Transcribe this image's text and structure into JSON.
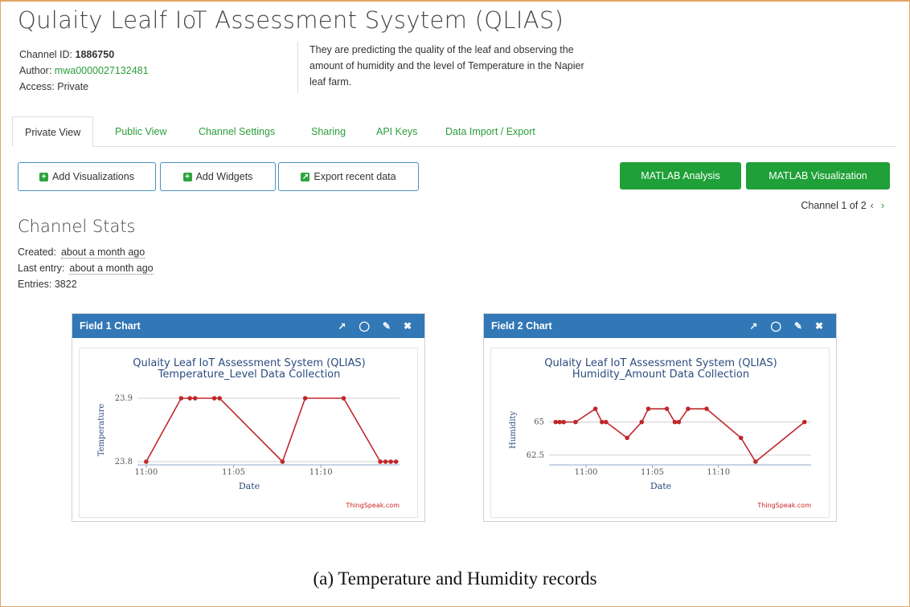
{
  "header": {
    "title": "Qulaity Lealf IoT Assessment Sysytem (QLIAS)",
    "channel_id_label": "Channel ID:",
    "channel_id": "1886750",
    "author_label": "Author:",
    "author": "mwa0000027132481",
    "access": "Access: Private",
    "description": "They are predicting the quality of the leaf and observing the amount of humidity and the level of Temperature in the Napier leaf farm."
  },
  "tabs": [
    "Private View",
    "Public View",
    "Channel Settings",
    "Sharing",
    "API Keys",
    "Data Import / Export"
  ],
  "toolbar": {
    "add_visualizations": "Add Visualizations",
    "add_widgets": "Add Widgets",
    "export_recent": "Export recent data",
    "matlab_analysis": "MATLAB Analysis",
    "matlab_visualization": "MATLAB Visualization",
    "pager": "Channel 1 of 2",
    "accent": "#1fa038"
  },
  "stats": {
    "heading": "Channel Stats",
    "created_label": "Created:",
    "created": "about a month ago",
    "last_entry_label": "Last entry:",
    "last_entry": "about a month ago",
    "entries": "Entries: 3822"
  },
  "panels": [
    {
      "header": "Field 1 Chart"
    },
    {
      "header": "Field 2 Chart"
    }
  ],
  "icons": [
    "external-link-icon",
    "comment-icon",
    "pencil-icon",
    "close-icon"
  ],
  "caption": "(a) Temperature and Humidity records",
  "chart_data": [
    {
      "type": "line",
      "title": "Qulaity Leaf IoT Assessment System (QLIAS)",
      "subtitle": "Temperature_Level Data Collection",
      "xlabel": "Date",
      "ylabel": "Temperature",
      "credit": "ThingSpeak.com",
      "x_ticks": [
        "11:00",
        "11:05",
        "11:10"
      ],
      "y_ticks": [
        23.8,
        23.9
      ],
      "ylim": [
        23.8,
        23.9
      ],
      "xlim_min": [
        10.8,
        12.8
      ],
      "color": "#c0282c",
      "series": [
        {
          "x_min": [
            0,
            2,
            2.5,
            2.8,
            3.9,
            4.2,
            7.8,
            9.1,
            11.3,
            13.4,
            13.7,
            14.0,
            14.3
          ],
          "values": [
            23.8,
            23.9,
            23.9,
            23.9,
            23.9,
            23.9,
            23.8,
            23.9,
            23.9,
            23.8,
            23.8,
            23.8,
            23.8
          ]
        }
      ]
    },
    {
      "type": "line",
      "title": "Qulaity Leaf IoT Assessment System (QLIAS)",
      "subtitle": "Humidity_Amount Data Collection",
      "xlabel": "Date",
      "ylabel": "Humidity",
      "credit": "ThingSpeak.com",
      "x_ticks": [
        "11:00",
        "11:05",
        "11:10"
      ],
      "y_ticks": [
        62.5,
        65
      ],
      "ylim": [
        62,
        66.8
      ],
      "color": "#c0282c",
      "series": [
        {
          "x_min": [
            -2.3,
            -2.0,
            -1.7,
            -0.8,
            0.7,
            1.2,
            1.5,
            3.1,
            4.2,
            4.7,
            6.1,
            6.7,
            7.0,
            7.7,
            9.1,
            11.7,
            12.8,
            16.5
          ],
          "values": [
            65.0,
            65.0,
            65.0,
            65.0,
            66.0,
            65.0,
            65.0,
            63.8,
            65.0,
            66.0,
            66.0,
            65.0,
            65.0,
            66.0,
            66.0,
            63.8,
            62.0,
            65.0
          ]
        }
      ]
    }
  ]
}
